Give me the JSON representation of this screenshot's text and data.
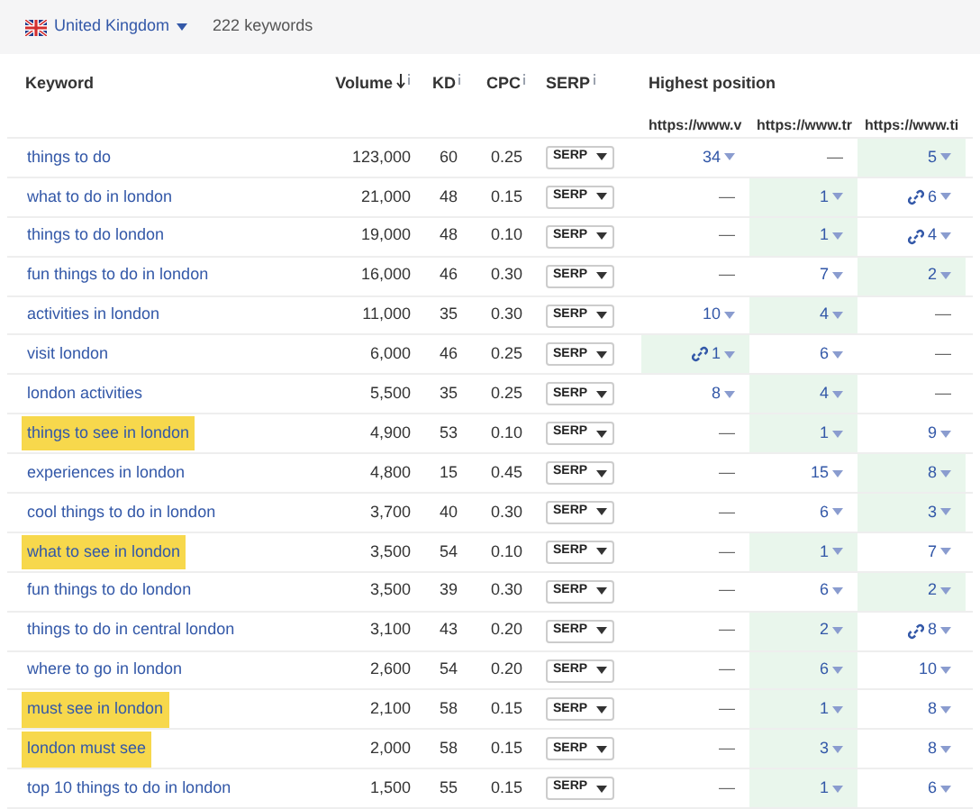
{
  "toolbar": {
    "country": "United Kingdom",
    "count": "222 keywords"
  },
  "columns": {
    "keyword": "Keyword",
    "volume": "Volume",
    "kd": "KD",
    "cpc": "CPC",
    "serp": "SERP",
    "position": "Highest position",
    "urls": [
      "https://www.v",
      "https://www.tr",
      "https://www.ti"
    ]
  },
  "rows": [
    {
      "keyword": "things to do",
      "highlighted": false,
      "volume": "123,000",
      "kd": "60",
      "cpc": "0.25",
      "serp": "SERP",
      "positions": [
        {
          "value": "34",
          "linked": false,
          "best": false
        },
        {
          "value": "—",
          "linked": false,
          "best": false
        },
        {
          "value": "5",
          "linked": false,
          "best": true
        }
      ]
    },
    {
      "keyword": "what to do in london",
      "highlighted": false,
      "volume": "21,000",
      "kd": "48",
      "cpc": "0.15",
      "serp": "SERP",
      "positions": [
        {
          "value": "—",
          "linked": false,
          "best": false
        },
        {
          "value": "1",
          "linked": false,
          "best": true
        },
        {
          "value": "6",
          "linked": true,
          "best": false
        }
      ]
    },
    {
      "keyword": "things to do london",
      "highlighted": false,
      "volume": "19,000",
      "kd": "48",
      "cpc": "0.10",
      "serp": "SERP",
      "positions": [
        {
          "value": "—",
          "linked": false,
          "best": false
        },
        {
          "value": "1",
          "linked": false,
          "best": true
        },
        {
          "value": "4",
          "linked": true,
          "best": false
        }
      ]
    },
    {
      "keyword": "fun things to do in london",
      "highlighted": false,
      "volume": "16,000",
      "kd": "46",
      "cpc": "0.30",
      "serp": "SERP",
      "positions": [
        {
          "value": "—",
          "linked": false,
          "best": false
        },
        {
          "value": "7",
          "linked": false,
          "best": false
        },
        {
          "value": "2",
          "linked": false,
          "best": true
        }
      ]
    },
    {
      "keyword": "activities in london",
      "highlighted": false,
      "volume": "11,000",
      "kd": "35",
      "cpc": "0.30",
      "serp": "SERP",
      "positions": [
        {
          "value": "10",
          "linked": false,
          "best": false
        },
        {
          "value": "4",
          "linked": false,
          "best": true
        },
        {
          "value": "—",
          "linked": false,
          "best": false
        }
      ]
    },
    {
      "keyword": "visit london",
      "highlighted": false,
      "volume": "6,000",
      "kd": "46",
      "cpc": "0.25",
      "serp": "SERP",
      "positions": [
        {
          "value": "1",
          "linked": true,
          "best": true
        },
        {
          "value": "6",
          "linked": false,
          "best": false
        },
        {
          "value": "—",
          "linked": false,
          "best": false
        }
      ]
    },
    {
      "keyword": "london activities",
      "highlighted": false,
      "volume": "5,500",
      "kd": "35",
      "cpc": "0.25",
      "serp": "SERP",
      "positions": [
        {
          "value": "8",
          "linked": false,
          "best": false
        },
        {
          "value": "4",
          "linked": false,
          "best": true
        },
        {
          "value": "—",
          "linked": false,
          "best": false
        }
      ]
    },
    {
      "keyword": "things to see in london",
      "highlighted": true,
      "volume": "4,900",
      "kd": "53",
      "cpc": "0.10",
      "serp": "SERP",
      "positions": [
        {
          "value": "—",
          "linked": false,
          "best": false
        },
        {
          "value": "1",
          "linked": false,
          "best": true
        },
        {
          "value": "9",
          "linked": false,
          "best": false
        }
      ]
    },
    {
      "keyword": "experiences in london",
      "highlighted": false,
      "volume": "4,800",
      "kd": "15",
      "cpc": "0.45",
      "serp": "SERP",
      "positions": [
        {
          "value": "—",
          "linked": false,
          "best": false
        },
        {
          "value": "15",
          "linked": false,
          "best": false
        },
        {
          "value": "8",
          "linked": false,
          "best": true
        }
      ]
    },
    {
      "keyword": "cool things to do in london",
      "highlighted": false,
      "volume": "3,700",
      "kd": "40",
      "cpc": "0.30",
      "serp": "SERP",
      "positions": [
        {
          "value": "—",
          "linked": false,
          "best": false
        },
        {
          "value": "6",
          "linked": false,
          "best": false
        },
        {
          "value": "3",
          "linked": false,
          "best": true
        }
      ]
    },
    {
      "keyword": "what to see in london",
      "highlighted": true,
      "volume": "3,500",
      "kd": "54",
      "cpc": "0.10",
      "serp": "SERP",
      "positions": [
        {
          "value": "—",
          "linked": false,
          "best": false
        },
        {
          "value": "1",
          "linked": false,
          "best": true
        },
        {
          "value": "7",
          "linked": false,
          "best": false
        }
      ]
    },
    {
      "keyword": "fun things to do london",
      "highlighted": false,
      "volume": "3,500",
      "kd": "39",
      "cpc": "0.30",
      "serp": "SERP",
      "positions": [
        {
          "value": "—",
          "linked": false,
          "best": false
        },
        {
          "value": "6",
          "linked": false,
          "best": false
        },
        {
          "value": "2",
          "linked": false,
          "best": true
        }
      ]
    },
    {
      "keyword": "things to do in central london",
      "highlighted": false,
      "volume": "3,100",
      "kd": "43",
      "cpc": "0.20",
      "serp": "SERP",
      "positions": [
        {
          "value": "—",
          "linked": false,
          "best": false
        },
        {
          "value": "2",
          "linked": false,
          "best": true
        },
        {
          "value": "8",
          "linked": true,
          "best": false
        }
      ]
    },
    {
      "keyword": "where to go in london",
      "highlighted": false,
      "volume": "2,600",
      "kd": "54",
      "cpc": "0.20",
      "serp": "SERP",
      "positions": [
        {
          "value": "—",
          "linked": false,
          "best": false
        },
        {
          "value": "6",
          "linked": false,
          "best": true
        },
        {
          "value": "10",
          "linked": false,
          "best": false
        }
      ]
    },
    {
      "keyword": "must see in london",
      "highlighted": true,
      "volume": "2,100",
      "kd": "58",
      "cpc": "0.15",
      "serp": "SERP",
      "positions": [
        {
          "value": "—",
          "linked": false,
          "best": false
        },
        {
          "value": "1",
          "linked": false,
          "best": true
        },
        {
          "value": "8",
          "linked": false,
          "best": false
        }
      ]
    },
    {
      "keyword": "london must see",
      "highlighted": true,
      "volume": "2,000",
      "kd": "58",
      "cpc": "0.15",
      "serp": "SERP",
      "positions": [
        {
          "value": "—",
          "linked": false,
          "best": false
        },
        {
          "value": "3",
          "linked": false,
          "best": true
        },
        {
          "value": "8",
          "linked": false,
          "best": false
        }
      ]
    },
    {
      "keyword": "top 10 things to do in london",
      "highlighted": false,
      "volume": "1,500",
      "kd": "55",
      "cpc": "0.15",
      "serp": "SERP",
      "positions": [
        {
          "value": "—",
          "linked": false,
          "best": false
        },
        {
          "value": "1",
          "linked": false,
          "best": true
        },
        {
          "value": "6",
          "linked": false,
          "best": false
        }
      ]
    }
  ]
}
